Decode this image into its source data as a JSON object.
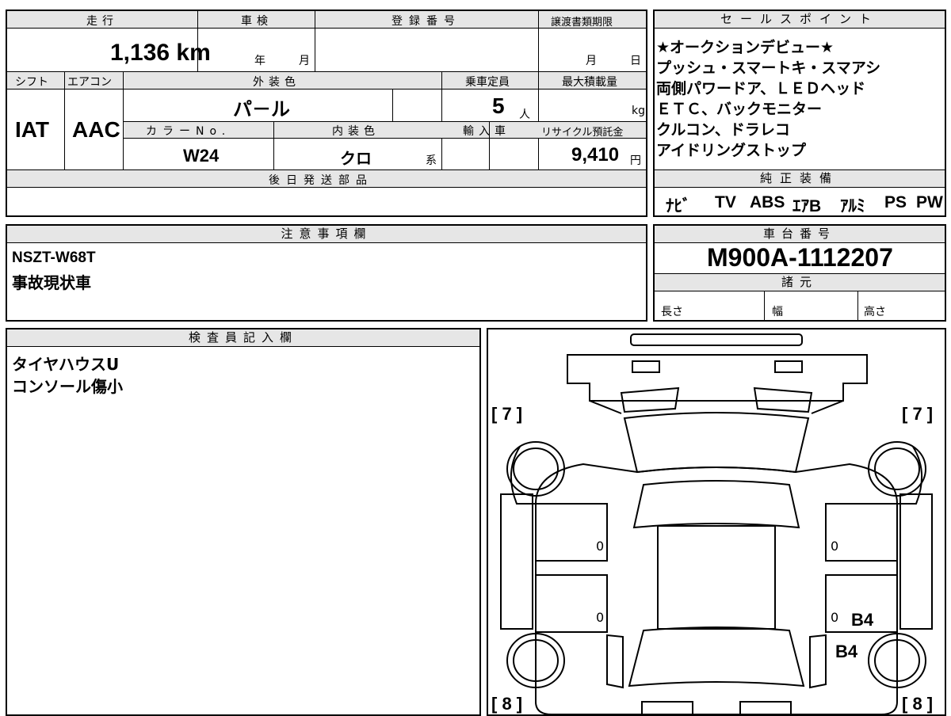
{
  "top": {
    "h_mileage": "走行",
    "mileage": "1,136 km",
    "h_inspection": "車検",
    "insp_year": "年",
    "insp_month": "月",
    "h_reg": "登録番号",
    "h_deadline": "譲渡書類期限",
    "dl_month": "月",
    "dl_day": "日",
    "h_shift": "シフト",
    "shift": "IAT",
    "h_ac": "エアコン",
    "ac": "AAC",
    "h_ext": "外装色",
    "ext": "パ－ル",
    "h_seats": "乗車定員",
    "seats": "5",
    "seats_unit": "人",
    "h_load": "最大積載量",
    "load_unit": "kg",
    "h_color_no": "カラーNo.",
    "color_no": "W24",
    "h_int": "内装色",
    "int": "クロ",
    "int_suffix": "系",
    "h_import": "輸入車",
    "h_recycle": "リサイクル預託金",
    "recycle": "9,410",
    "recycle_unit": "円",
    "h_later": "後日発送部品"
  },
  "sales": {
    "header": "セールスポイント",
    "lines": [
      "★オークションデビュー★",
      "プッシュ・スマートキ・スマアシ",
      "両側パワードア、ＬＥＤヘッド",
      "ＥＴＣ、バックモニター",
      "クルコン、ドラレコ",
      "アイドリングストップ"
    ]
  },
  "equip": {
    "header": "純正装備",
    "items": [
      "ﾅﾋﾞ",
      "TV",
      "ABS",
      "ｴｱB",
      "ｱﾙﾐ",
      "PS",
      "PW"
    ]
  },
  "notes": {
    "header": "注意事項欄",
    "lines": [
      "NSZT-W68T",
      "事故現状車"
    ]
  },
  "chassis": {
    "header": "車台番号",
    "number": "M900A-1112207",
    "spec_header": "諸元",
    "length": "長さ",
    "width": "幅",
    "height": "高さ"
  },
  "inspector": {
    "header": "検査員記入欄",
    "lines": [
      "タイヤハウスU",
      "コンソール傷小"
    ]
  },
  "diagram": {
    "tl": "[ 7 ]",
    "tr": "[ 7 ]",
    "bl": "[ 8 ]",
    "br": "[ 8 ]",
    "door_fl": "0",
    "door_fr": "0",
    "door_rl": "0",
    "door_rr": "0",
    "mark1": "B4",
    "mark2": "B4"
  }
}
